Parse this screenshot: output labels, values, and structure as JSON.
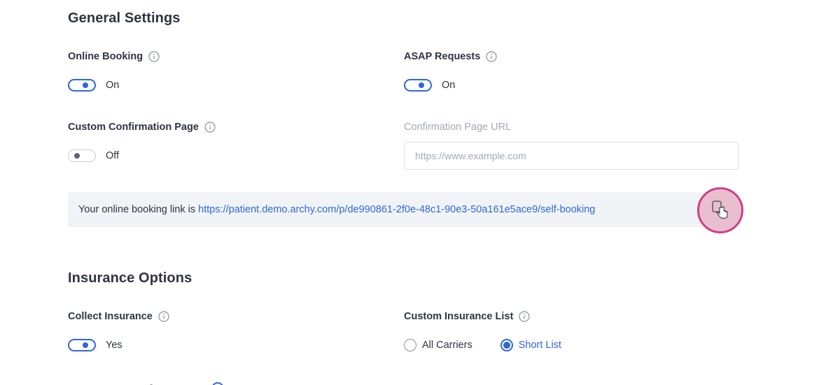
{
  "general": {
    "title": "General Settings",
    "online_booking": {
      "label": "Online Booking",
      "state": "On"
    },
    "asap_requests": {
      "label": "ASAP Requests",
      "state": "On"
    },
    "custom_confirmation": {
      "label": "Custom Confirmation Page",
      "state": "Off"
    },
    "confirmation_url": {
      "label": "Confirmation Page URL",
      "placeholder": "https://www.example.com",
      "value": ""
    },
    "booking_link": {
      "prefix": "Your online booking link is",
      "url": "https://patient.demo.archy.com/p/de990861-2f0e-48c1-90e3-50a161e5ace9/self-booking"
    }
  },
  "insurance": {
    "title": "Insurance Options",
    "collect_insurance": {
      "label": "Collect Insurance",
      "state": "Yes"
    },
    "custom_list": {
      "label": "Custom Insurance List",
      "options": [
        "All Carriers",
        "Short List"
      ],
      "selected": "Short List"
    }
  },
  "colors": {
    "accent": "#2f66e0",
    "highlight_ring": "#cf3f87",
    "link_box_bg": "#f1f4f6"
  },
  "icons": {
    "info": "info-icon",
    "copy": "copy-icon",
    "cursor": "hand-pointer-icon"
  }
}
